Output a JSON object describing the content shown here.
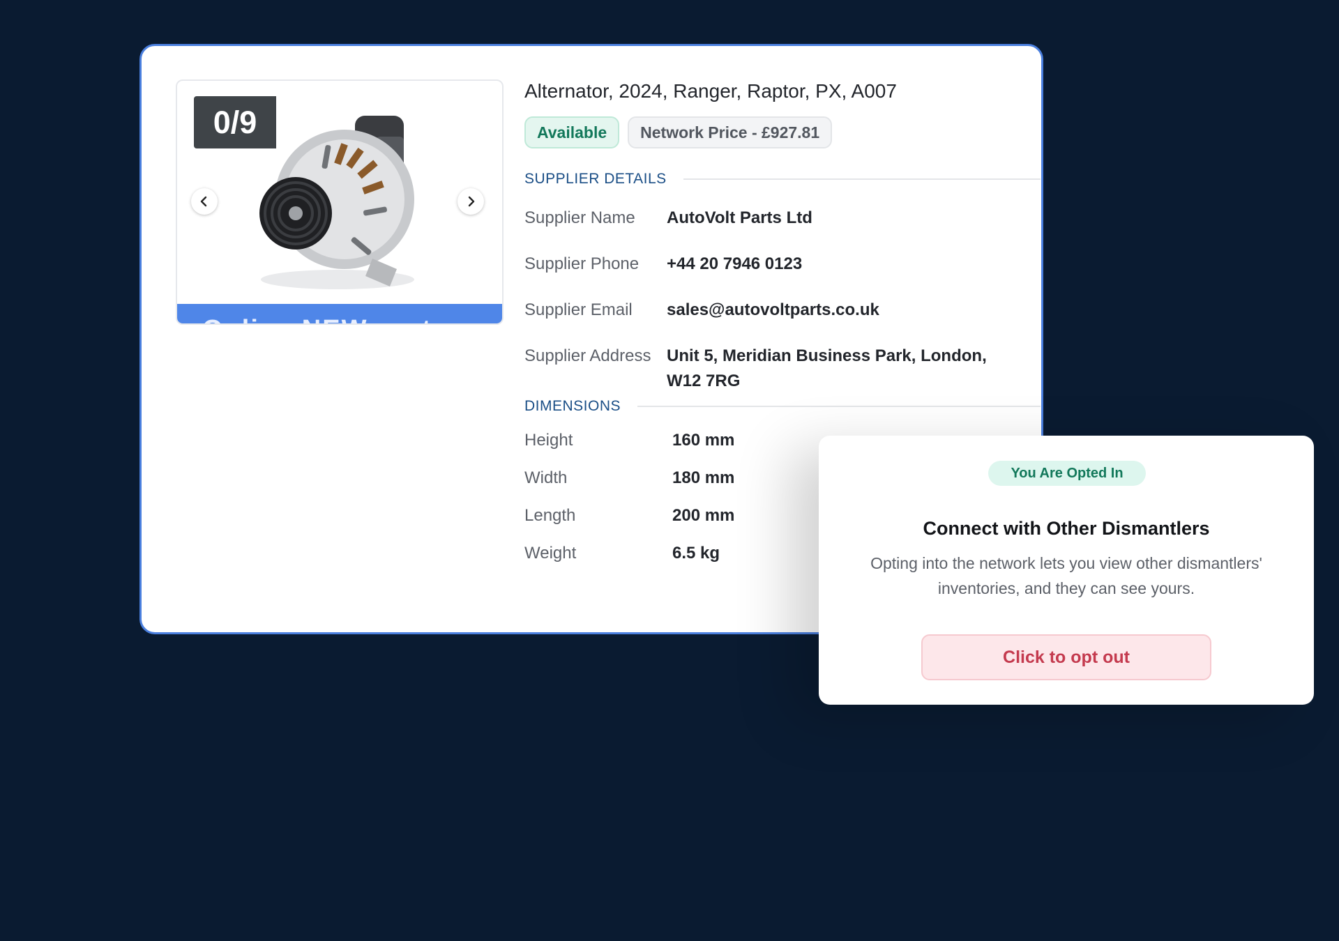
{
  "gallery": {
    "counter": "0/9",
    "banner_text": "Online NEW parts"
  },
  "part": {
    "title": "Alternator, 2024, Ranger, Raptor, PX, A007",
    "availability": "Available",
    "network_price": "Network Price - £927.81"
  },
  "supplier": {
    "section_title": "SUPPLIER DETAILS",
    "rows": [
      {
        "label": "Supplier Name",
        "value": "AutoVolt Parts Ltd"
      },
      {
        "label": "Supplier Phone",
        "value": "+44 20 7946 0123"
      },
      {
        "label": "Supplier Email",
        "value": "sales@autovoltparts.co.uk"
      },
      {
        "label": "Supplier Address",
        "value": "Unit 5, Meridian Business Park, London, W12 7RG"
      }
    ]
  },
  "dimensions": {
    "section_title": "DIMENSIONS",
    "rows": [
      {
        "label": "Height",
        "value": "160 mm"
      },
      {
        "label": "Width",
        "value": "180 mm"
      },
      {
        "label": "Length",
        "value": "200 mm"
      },
      {
        "label": "Weight",
        "value": "6.5 kg"
      }
    ]
  },
  "network_popup": {
    "status": "You Are Opted In",
    "heading": "Connect with Other Dismantlers",
    "description": "Opting into the network lets you view other dismantlers' inventories, and they can see yours.",
    "button_label": "Click to opt out"
  },
  "icons": {
    "prev": "chevron-left-icon",
    "next": "chevron-right-icon"
  },
  "colors": {
    "page_background": "#0a1b31",
    "card_border": "#4a7fde",
    "available": "#12785a",
    "section_title": "#1a4e86",
    "opt_out": "#c43a4e"
  }
}
